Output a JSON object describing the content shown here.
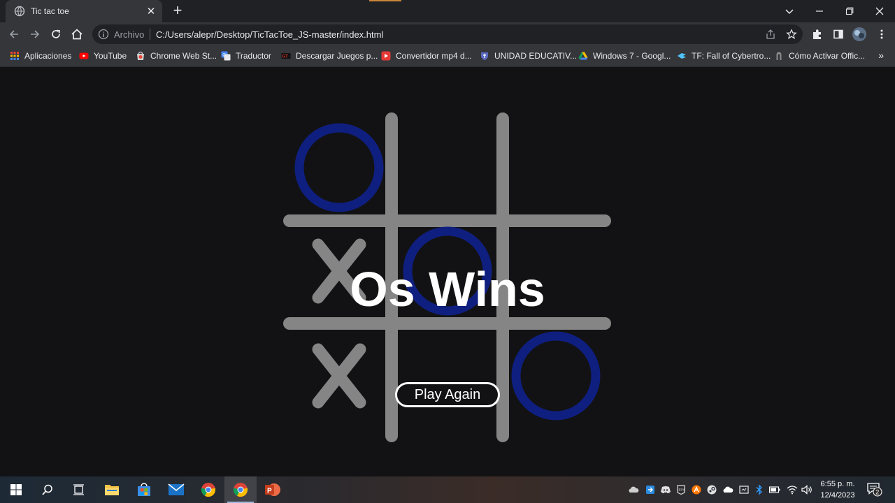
{
  "browser": {
    "tab": {
      "title": "Tic tac toe",
      "close": "✕"
    },
    "new_tab": "+",
    "controls": {
      "tab_search": "⌄",
      "minimize": "—",
      "restore": "❐",
      "close": "✕"
    },
    "address": {
      "security_label": "Archivo",
      "url": "C:/Users/alepr/Desktop/TicTacToe_JS-master/index.html"
    },
    "bookmarks": [
      {
        "label": "Aplicaciones",
        "icon": "apps-grid-icon",
        "color": "#e8eaed"
      },
      {
        "label": "YouTube",
        "icon": "youtube-icon",
        "color": "#ff0000"
      },
      {
        "label": "Chrome Web St...",
        "icon": "chrome-web-store-icon",
        "color": "#ea4335"
      },
      {
        "label": "Traductor",
        "icon": "google-translate-icon",
        "color": "#4285f4"
      },
      {
        "label": "Descargar Juegos p...",
        "icon": "games-site-icon",
        "color": "#d93025"
      },
      {
        "label": "Convertidor mp4 d...",
        "icon": "converter-icon",
        "color": "#e53935"
      },
      {
        "label": "UNIDAD EDUCATIV...",
        "icon": "school-crest-icon",
        "color": "#5c6bc0"
      },
      {
        "label": "Windows 7 - Googl...",
        "icon": "google-drive-icon",
        "color": "#fbbc04"
      },
      {
        "label": "TF: Fall of Cybertro...",
        "icon": "cybertron-icon",
        "color": "#4fc3f7"
      },
      {
        "label": "Cómo Activar Offic...",
        "icon": "office-site-icon",
        "color": "#9e9e9e"
      }
    ],
    "bookmarks_more": "»"
  },
  "game": {
    "board": [
      "O",
      "",
      "",
      "X",
      "O",
      "",
      "X",
      "",
      "O"
    ],
    "result": "Os Wins",
    "play_again_label": "Play Again",
    "colors": {
      "o": "#0f1f80",
      "x": "#858585",
      "grid": "#858585",
      "background": "#121214"
    }
  },
  "taskbar": {
    "time": "6:55 p. m.",
    "date": "12/4/2023",
    "notification_count": "2",
    "apps": [
      "start-icon",
      "search-icon",
      "task-view-icon",
      "file-explorer-icon",
      "microsoft-store-icon",
      "mail-icon",
      "chrome-icon",
      "chrome-active-icon",
      "powerpoint-icon"
    ],
    "tray": [
      "onedrive-icon",
      "app-tray-icon",
      "discord-icon",
      "epic-games-icon",
      "avast-icon",
      "steam-icon",
      "cloud-icon",
      "device-icon",
      "bluetooth-icon",
      "battery-icon",
      "wifi-icon",
      "volume-icon"
    ]
  }
}
